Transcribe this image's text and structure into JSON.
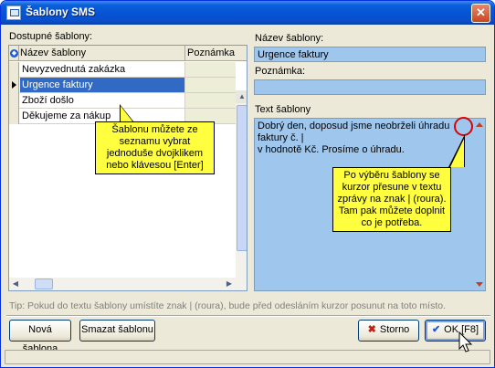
{
  "window": {
    "title": "Šablony SMS",
    "close": "✕"
  },
  "left": {
    "label": "Dostupné šablony:",
    "columns": {
      "name": "Název šablony",
      "note": "Poznámka"
    },
    "rows": [
      {
        "name": "Nevyzvednutá zakázka",
        "note": ""
      },
      {
        "name": "Urgence faktury",
        "note": "",
        "selected": true
      },
      {
        "name": "Zboží došlo",
        "note": ""
      },
      {
        "name": "Děkujeme za nákup",
        "note": ""
      }
    ]
  },
  "right": {
    "name_label": "Název šablony:",
    "name_value": "Urgence faktury",
    "note_label": "Poznámka:",
    "note_value": "",
    "text_label": "Text šablony",
    "text_line1": "Dobrý den, doposud jsme neobrželi úhradu faktury č. |",
    "text_line2": "v hodnotě Kč. Prosíme o úhradu."
  },
  "callouts": {
    "left": [
      "Šablonu můžete ze",
      "seznamu vybrat",
      "jednoduše dvojklikem",
      "nebo klávesou [Enter]"
    ],
    "right": [
      "Po výběru šablony se",
      "kurzor přesune v textu",
      "zprávy na znak | (roura).",
      "Tam pak můžete doplnit",
      "co je potřeba."
    ]
  },
  "tip": "Tip: Pokud do textu šablony umístíte znak | (roura), bude před odesláním kurzor posunut na toto místo.",
  "buttons": {
    "new": "Nová šablona",
    "delete": "Smazat šablonu",
    "cancel": "Storno",
    "ok": "OK [F8]"
  },
  "colors": {
    "field_bg": "#9fc6ec",
    "selection": "#316ac5",
    "callout_bg": "#ffff40",
    "highlight_ring": "#e00000"
  }
}
